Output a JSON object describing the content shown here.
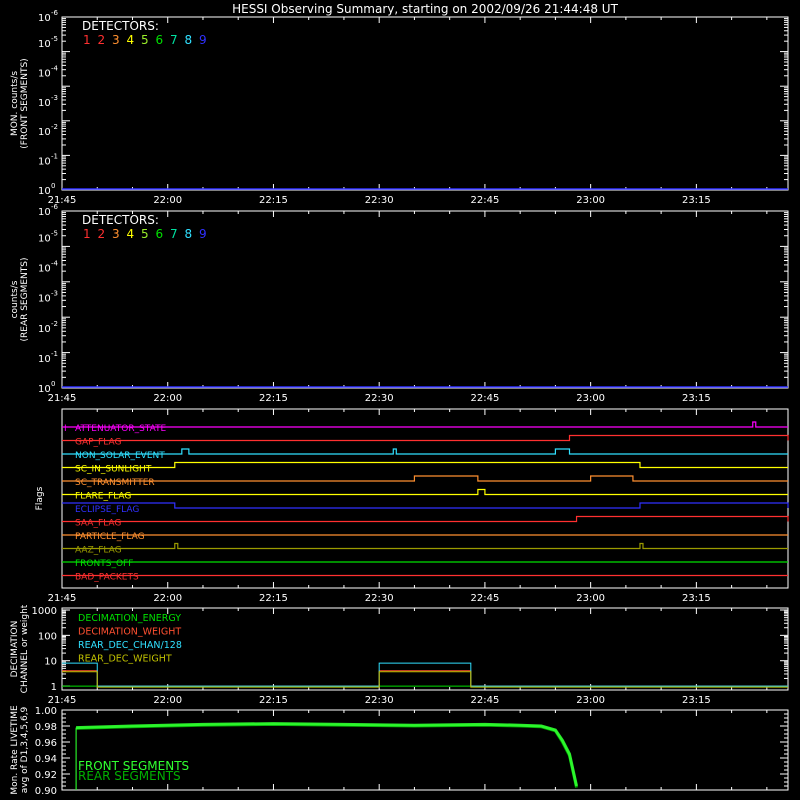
{
  "title": "HESSI Observing Summary, starting on 2002/09/26 21:44:48 UT",
  "colors": {
    "background": "#000000",
    "axes": "#ffffff",
    "detectors": [
      "#ff3030",
      "#ff3030",
      "#ff9030",
      "#ffff00",
      "#9aee2a",
      "#00e000",
      "#00e0a0",
      "#30e0ff",
      "#3030ff"
    ]
  },
  "chart_data": [
    {
      "type": "line",
      "panel": "front",
      "ylabel": [
        "MON. counts/s",
        "(FRONT SEGMENTS)"
      ],
      "y_scale": "log",
      "ylim": [
        1,
        100000
      ],
      "ytick_labels": [
        {
          "base": "10",
          "exp": "0"
        },
        {
          "base": "10",
          "exp": "-1"
        },
        {
          "base": "10",
          "exp": "-2"
        },
        {
          "base": "10",
          "exp": "-3"
        },
        {
          "base": "10",
          "exp": "-4"
        },
        {
          "base": "10",
          "exp": "-5"
        },
        {
          "base": "10",
          "exp": "-6"
        }
      ],
      "xlim": [
        "21:45",
        "23:28"
      ],
      "xtick_labels": [
        "21:45",
        "22:00",
        "22:15",
        "22:30",
        "22:45",
        "23:00",
        "23:15"
      ],
      "legend_title": "DETECTORS:",
      "legend_items": [
        "1",
        "2",
        "3",
        "4",
        "5",
        "6",
        "7",
        "8",
        "9"
      ],
      "series": [
        {
          "x": [
            "21:45",
            "23:28"
          ],
          "y": [
            1,
            1
          ]
        }
      ]
    },
    {
      "type": "line",
      "panel": "rear",
      "ylabel": [
        "counts/s",
        "(REAR SEGMENTS)"
      ],
      "y_scale": "log",
      "ylim": [
        1,
        100000
      ],
      "ytick_labels": [
        {
          "base": "10",
          "exp": "0"
        },
        {
          "base": "10",
          "exp": "-1"
        },
        {
          "base": "10",
          "exp": "-2"
        },
        {
          "base": "10",
          "exp": "-3"
        },
        {
          "base": "10",
          "exp": "-4"
        },
        {
          "base": "10",
          "exp": "-5"
        },
        {
          "base": "10",
          "exp": "-6"
        }
      ],
      "xlim": [
        "21:45",
        "23:28"
      ],
      "xtick_labels": [
        "21:45",
        "22:00",
        "22:15",
        "22:30",
        "22:45",
        "23:00",
        "23:15"
      ],
      "legend_title": "DETECTORS:",
      "legend_items": [
        "1",
        "2",
        "3",
        "4",
        "5",
        "6",
        "7",
        "8",
        "9"
      ],
      "series": [
        {
          "x": [
            "21:45",
            "23:28"
          ],
          "y": [
            1,
            1
          ]
        }
      ]
    },
    {
      "type": "line",
      "panel": "flags",
      "ylabel": [
        "Flags"
      ],
      "xlim": [
        "21:45",
        "23:28"
      ],
      "xtick_labels": [
        "21:45",
        "22:00",
        "22:15",
        "22:30",
        "22:45",
        "23:00",
        "23:15"
      ],
      "series": [
        {
          "name": "ATTENUATOR_STATE",
          "marker": "I",
          "color": "#ff00ff",
          "high": [
            [
              "23:23",
              "23:23"
            ]
          ]
        },
        {
          "name": "GAP_FLAG",
          "color": "#ff3030",
          "high": [
            [
              "22:57",
              "23:28"
            ]
          ]
        },
        {
          "name": "NON_SOLAR_EVENT",
          "color": "#30e0ff",
          "high": [
            [
              "22:02",
              "22:03"
            ],
            [
              "22:32",
              "22:32"
            ],
            [
              "22:55",
              "22:57"
            ]
          ]
        },
        {
          "name": "SC_IN_SUNLIGHT",
          "color": "#ffff00",
          "high": [
            [
              "22:01",
              "23:07"
            ]
          ]
        },
        {
          "name": "SC_TRANSMITTER",
          "color": "#ff9030",
          "high": [
            [
              "22:35",
              "22:44"
            ],
            [
              "23:00",
              "23:06"
            ]
          ]
        },
        {
          "name": "FLARE_FLAG",
          "color": "#ffff00",
          "high": [
            [
              "22:44",
              "22:45"
            ]
          ]
        },
        {
          "name": "ECLIPSE_FLAG",
          "color": "#3030ff",
          "high": [
            [
              "21:45",
              "22:01"
            ],
            [
              "23:07",
              "23:28"
            ]
          ]
        },
        {
          "name": "SAA_FLAG",
          "color": "#ff3030",
          "high": [
            [
              "22:58",
              "23:28"
            ]
          ]
        },
        {
          "name": "PARTICLE_FLAG",
          "color": "#ff9030",
          "high": []
        },
        {
          "name": "AAZ_FLAG",
          "color": "#9a9a00",
          "high": [
            [
              "22:01",
              "22:01"
            ],
            [
              "23:07",
              "23:07"
            ]
          ]
        },
        {
          "name": "FRONTS_OFF",
          "color": "#00e000",
          "high": []
        },
        {
          "name": "BAD_PACKETS",
          "color": "#ff3030",
          "high": []
        }
      ]
    },
    {
      "type": "line",
      "panel": "decimation",
      "ylabel": [
        "DECIMATION",
        "CHANNEL or weight"
      ],
      "y_scale": "log",
      "ylim": [
        0.7,
        1200
      ],
      "ytick_labels": [
        "1",
        "10",
        "100",
        "1000"
      ],
      "xlim": [
        "21:45",
        "23:28"
      ],
      "xtick_labels": [
        "21:45",
        "22:00",
        "22:15",
        "22:30",
        "22:45",
        "23:00",
        "23:15"
      ],
      "series": [
        {
          "name": "DECIMATION_ENERGY",
          "color": "#00e000",
          "x": [
            "21:45",
            "23:28"
          ],
          "y": [
            1,
            1
          ]
        },
        {
          "name": "DECIMATION_WEIGHT",
          "color": "#ff5030",
          "x": [
            "21:45",
            "21:50",
            "21:50",
            "22:30",
            "22:30",
            "22:43",
            "22:43",
            "23:28"
          ],
          "y": [
            4,
            4,
            1,
            1,
            4,
            4,
            1,
            1
          ]
        },
        {
          "name": "REAR_DEC_CHAN/128",
          "color": "#30e0ff",
          "x": [
            "21:45",
            "21:50",
            "21:50",
            "22:30",
            "22:30",
            "22:43",
            "22:43",
            "23:28"
          ],
          "y": [
            8,
            8,
            1,
            1,
            8,
            8,
            1,
            1
          ]
        },
        {
          "name": "REAR_DEC_WEIGHT",
          "color": "#c0c000",
          "x": [
            "21:45",
            "21:50",
            "21:50",
            "22:30",
            "22:30",
            "22:43",
            "22:43",
            "23:28"
          ],
          "y": [
            4,
            4,
            1,
            1,
            4,
            4,
            1,
            1
          ]
        }
      ]
    },
    {
      "type": "line",
      "panel": "livetime",
      "ylabel": [
        "Mon. Rate LIVETIME",
        "avg of D1,3,4,5,6,9"
      ],
      "ylim": [
        0.9,
        1.0
      ],
      "ytick_labels": [
        "0.90",
        "0.92",
        "0.94",
        "0.96",
        "0.98",
        "1.00"
      ],
      "xlim": [
        "21:45",
        "23:28"
      ],
      "legend_items": [
        "FRONT SEGMENTS",
        "REAR SEGMENTS"
      ],
      "series": [
        {
          "name": "FRONT SEGMENTS",
          "color": "#30ff30",
          "x": [
            "21:47",
            "21:55",
            "22:05",
            "22:15",
            "22:25",
            "22:35",
            "22:45",
            "22:50",
            "22:53",
            "22:55",
            "22:56",
            "22:57",
            "22:58"
          ],
          "y": [
            0.978,
            0.98,
            0.982,
            0.983,
            0.982,
            0.981,
            0.982,
            0.981,
            0.98,
            0.975,
            0.962,
            0.945,
            0.905
          ]
        },
        {
          "name": "REAR SEGMENTS",
          "color": "#00b000",
          "x": [
            "21:47",
            "21:55",
            "22:05",
            "22:15",
            "22:25",
            "22:35",
            "22:45",
            "22:50",
            "22:53",
            "22:55",
            "22:56",
            "22:57",
            "22:58"
          ],
          "y": [
            0.977,
            0.979,
            0.981,
            0.982,
            0.981,
            0.98,
            0.981,
            0.98,
            0.979,
            0.974,
            0.96,
            0.943,
            0.903
          ]
        }
      ]
    }
  ]
}
